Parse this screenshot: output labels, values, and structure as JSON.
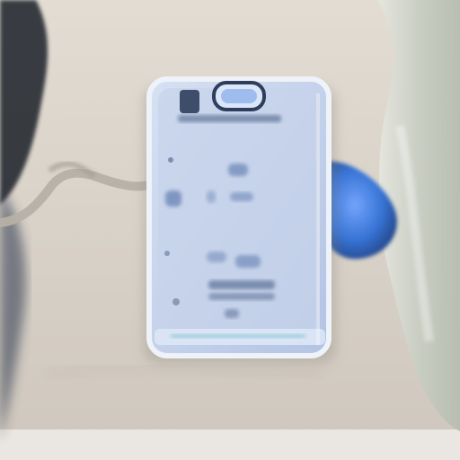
{
  "scene": {
    "subject": "handheld-device-back-cover",
    "colors": {
      "surface": "#ddd6cd",
      "surface_shadow": "#c9c1b6",
      "wall_left": "#bfb9b2",
      "device_body": "#c6d3ea",
      "device_edge": "#e9eef7",
      "device_dark": "#3a4a6a",
      "device_accent": "#5c7fb5",
      "blue_object": "#2f6fd6",
      "glass_right": "#c9cfc4",
      "dark_object": "#2b2f36",
      "cable": "#b7b0a6"
    }
  }
}
